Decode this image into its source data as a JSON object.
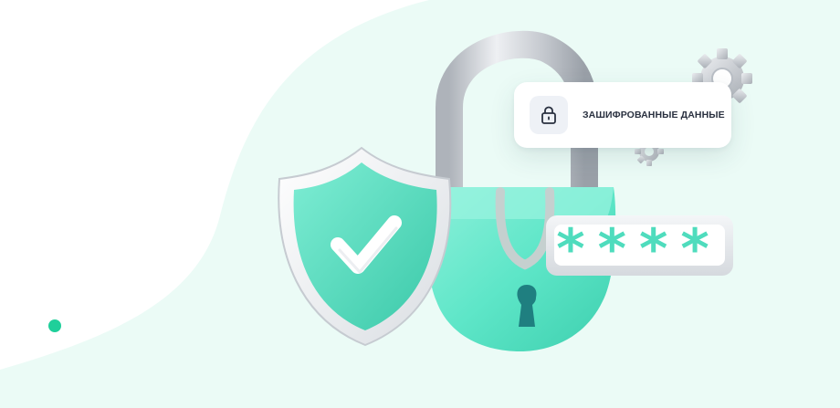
{
  "card": {
    "label": "ЗАШИФРОВАННЫЕ ДАННЫЕ",
    "icon": "lock-icon"
  },
  "password_field": {
    "masked_value": "****"
  },
  "illustration": {
    "shield_icon": "shield-check-icon",
    "padlock_icon": "padlock-icon",
    "gear_icon": "gear-icon"
  },
  "colors": {
    "background_blob": "#ebfbf6",
    "accent": "#5ee6c8",
    "accent_dark": "#37c9a8",
    "indicator_dot": "#1fcf9a",
    "metal": "#c9cdd3"
  }
}
